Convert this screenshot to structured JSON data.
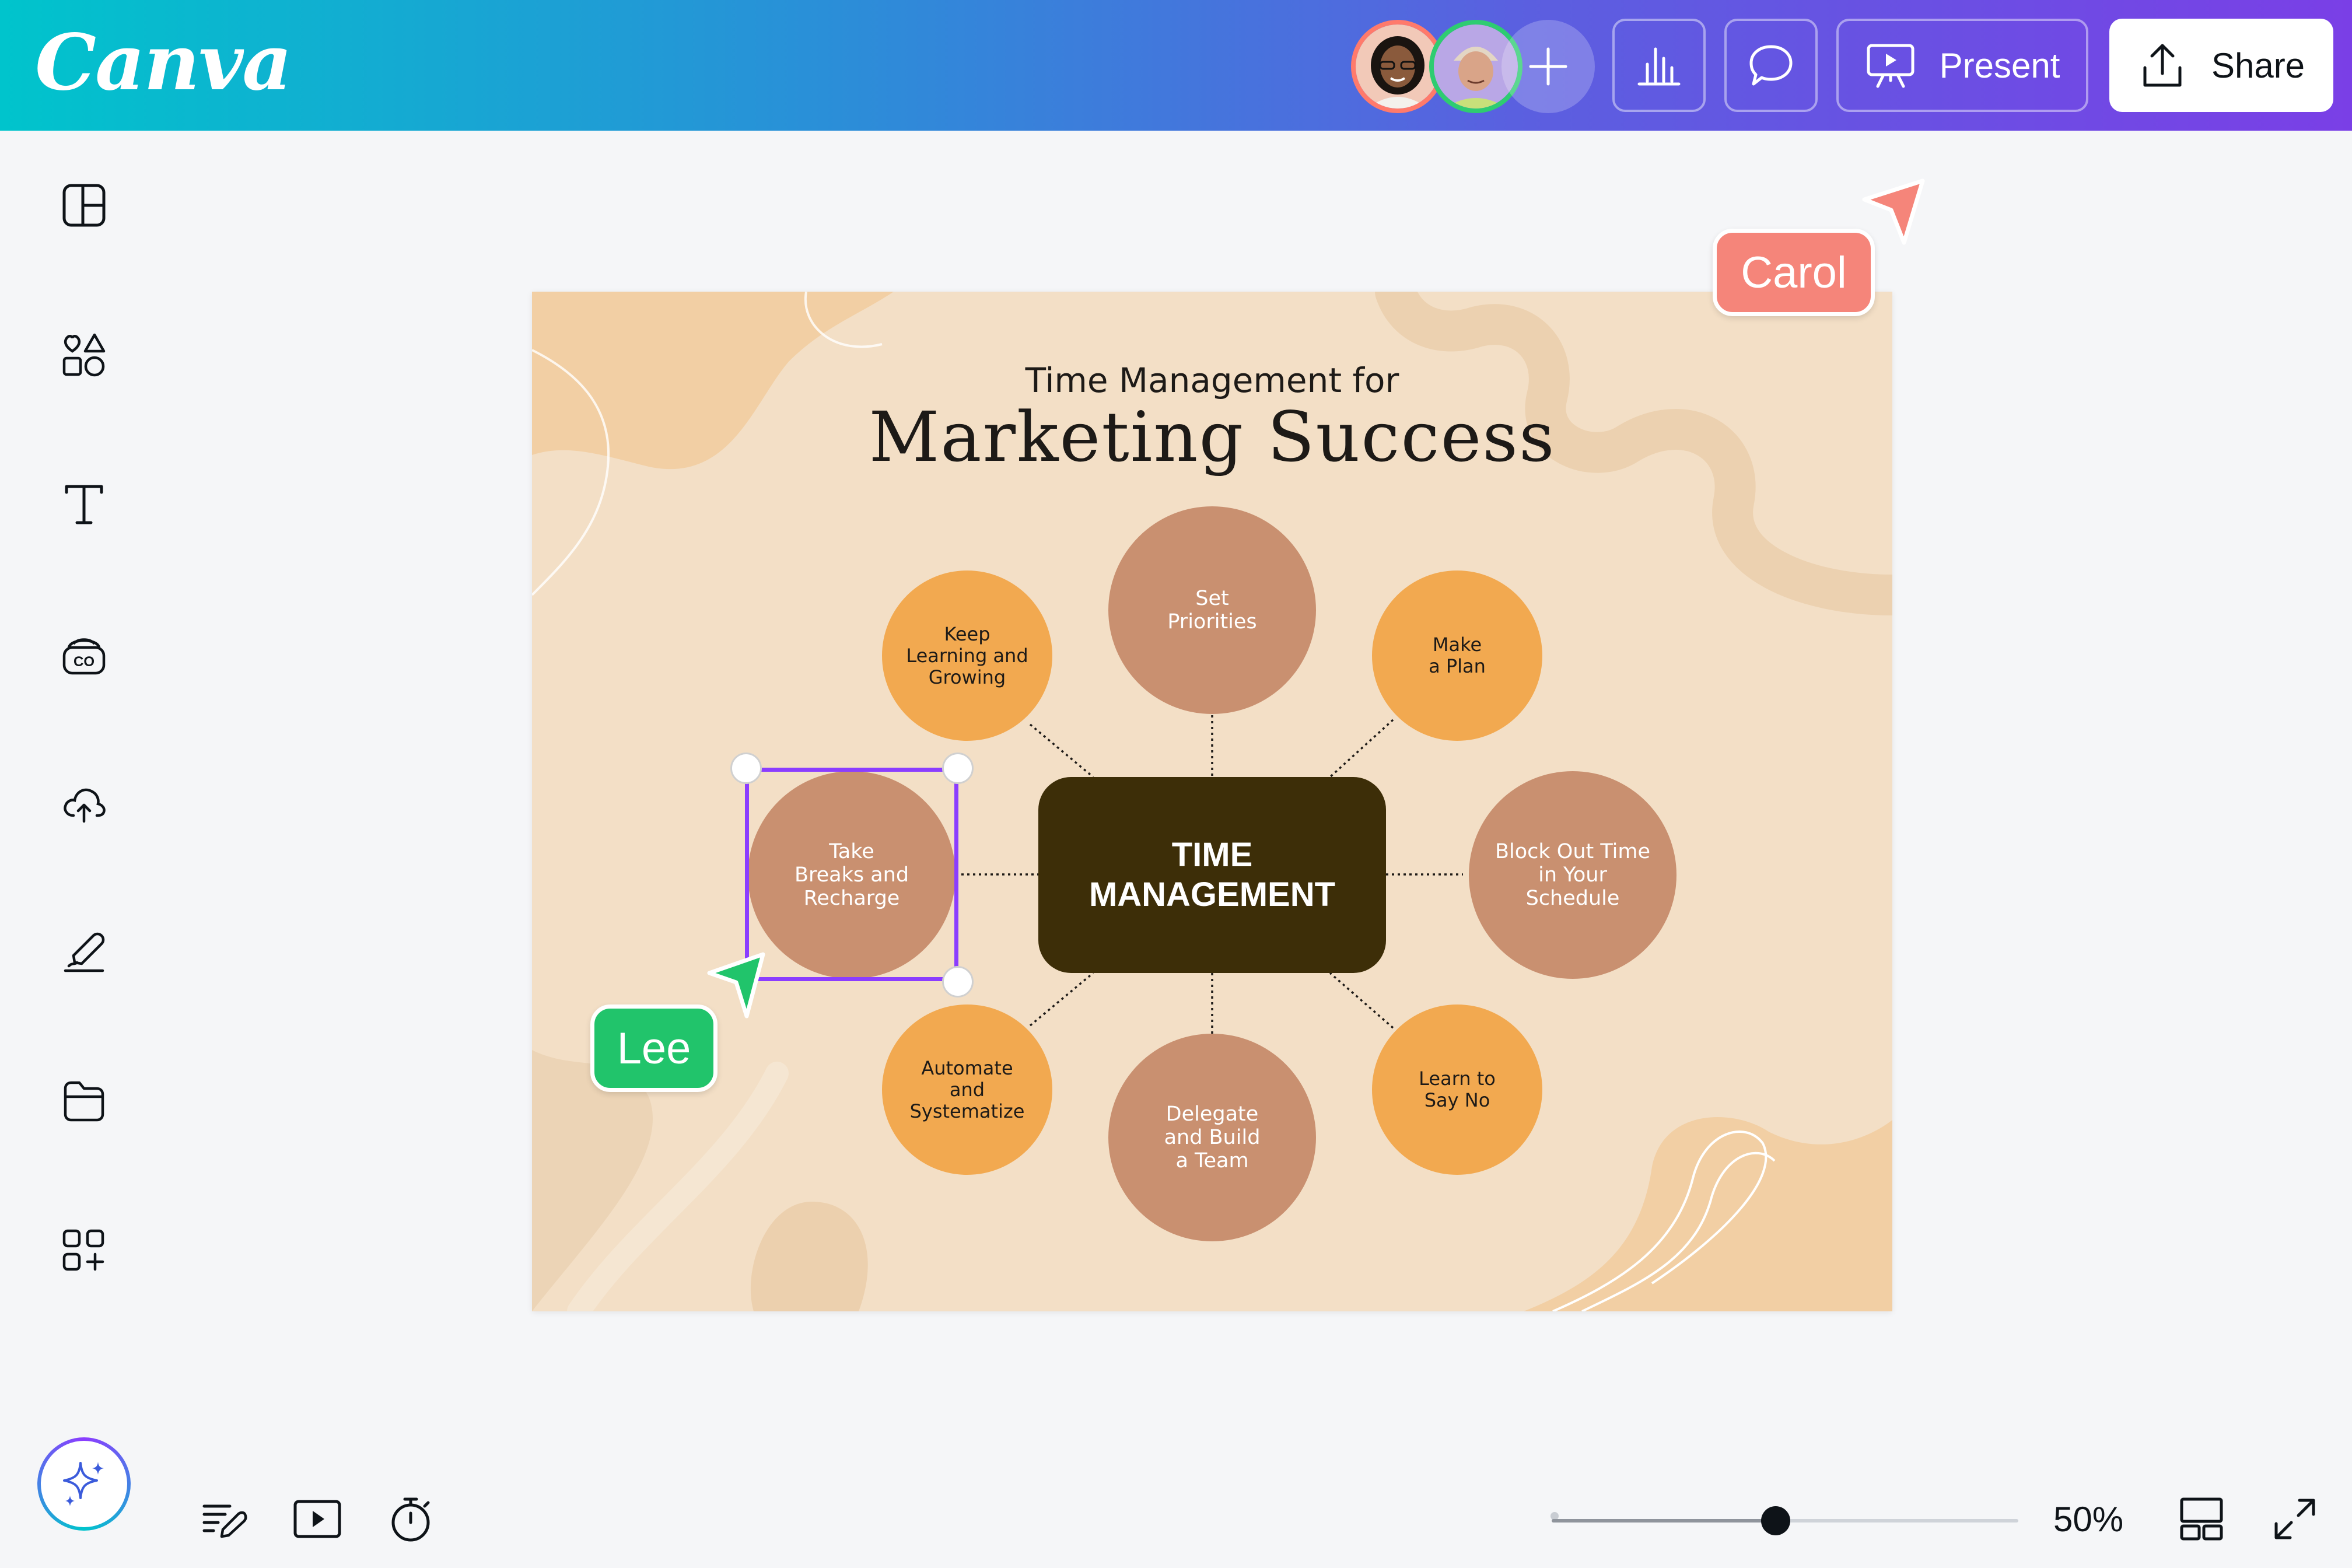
{
  "header": {
    "logo": "Canva",
    "present_label": "Present",
    "share_label": "Share",
    "collaborators": [
      "avatar-woman",
      "avatar-man"
    ]
  },
  "sidebar": {
    "items": [
      {
        "name": "sidebar-item-design",
        "icon": "layout-icon"
      },
      {
        "name": "sidebar-item-elements",
        "icon": "shapes-icon"
      },
      {
        "name": "sidebar-item-text",
        "icon": "text-icon"
      },
      {
        "name": "sidebar-item-brand",
        "icon": "brand-icon"
      },
      {
        "name": "sidebar-item-uploads",
        "icon": "cloud-upload-icon"
      },
      {
        "name": "sidebar-item-draw",
        "icon": "draw-icon"
      },
      {
        "name": "sidebar-item-projects",
        "icon": "folder-icon"
      },
      {
        "name": "sidebar-item-apps",
        "icon": "apps-icon"
      }
    ]
  },
  "footer": {
    "zoom_value": "50%",
    "zoom_fraction": 0.48
  },
  "design": {
    "title_small": "Time Management for",
    "title_big": "Marketing Success",
    "center": "TIME\nMANAGEMENT",
    "nodes": {
      "set_priorities": "Set\nPriorities",
      "keep_learning": "Keep\nLearning and\nGrowing",
      "make_plan": "Make\na Plan",
      "take_breaks": "Take\nBreaks and\nRecharge",
      "block_out": "Block Out Time\nin Your\nSchedule",
      "automate": "Automate\nand\nSystematize",
      "delegate": "Delegate\nand Build\na Team",
      "say_no": "Learn to\nSay No"
    }
  },
  "cursors": {
    "carol": {
      "name": "Carol",
      "color": "#f5857a"
    },
    "lee": {
      "name": "Lee",
      "color": "#21c46b"
    }
  },
  "colors": {
    "selection": "#8b3dff",
    "node_brown": "#c99070",
    "node_orange": "#f2a950",
    "center": "#3d2e08",
    "canvas_bg": "#f3dfc6"
  }
}
